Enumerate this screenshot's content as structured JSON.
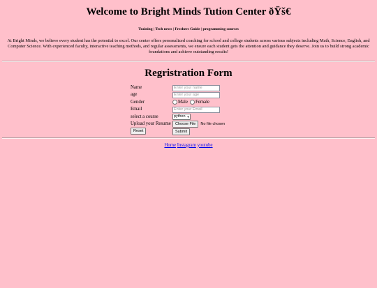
{
  "header": {
    "title": "Welcome to Bright Minds Tution Center ðŸš€"
  },
  "nav": {
    "items": [
      "Training",
      "Tech news",
      "Freshers Guide",
      "programming courses"
    ],
    "separator": " | "
  },
  "about": {
    "text": "At Bright Minds, we believe every student has the potential to excel. Our center offers personalized coaching for school and college students across various subjects including Math, Science, English, and Computer Science. With experienced faculty, interactive teaching methods, and regular assessments, we ensure each student gets the attention and guidance they deserve. Join us to build strong academic foundations and achieve outstanding results!"
  },
  "form": {
    "title": "Regristration Form",
    "name_label": "Name",
    "name_placeholder": "Enter your name",
    "age_label": "age",
    "age_placeholder": "Enter your age",
    "gender_label": "Gender",
    "gender_male": "Male",
    "gender_female": "Female",
    "email_label": "Email",
    "email_placeholder": "Enter your Email",
    "course_label": "select a course",
    "course_selected": "python",
    "resume_label": "Upload your Resume",
    "choose_file_label": "Choose File",
    "file_status": "No file chosen",
    "reset_label": "Reset",
    "submit_label": "Submit"
  },
  "footer": {
    "home": "Home",
    "instagram": "Instagram",
    "youtube": "youtube"
  }
}
